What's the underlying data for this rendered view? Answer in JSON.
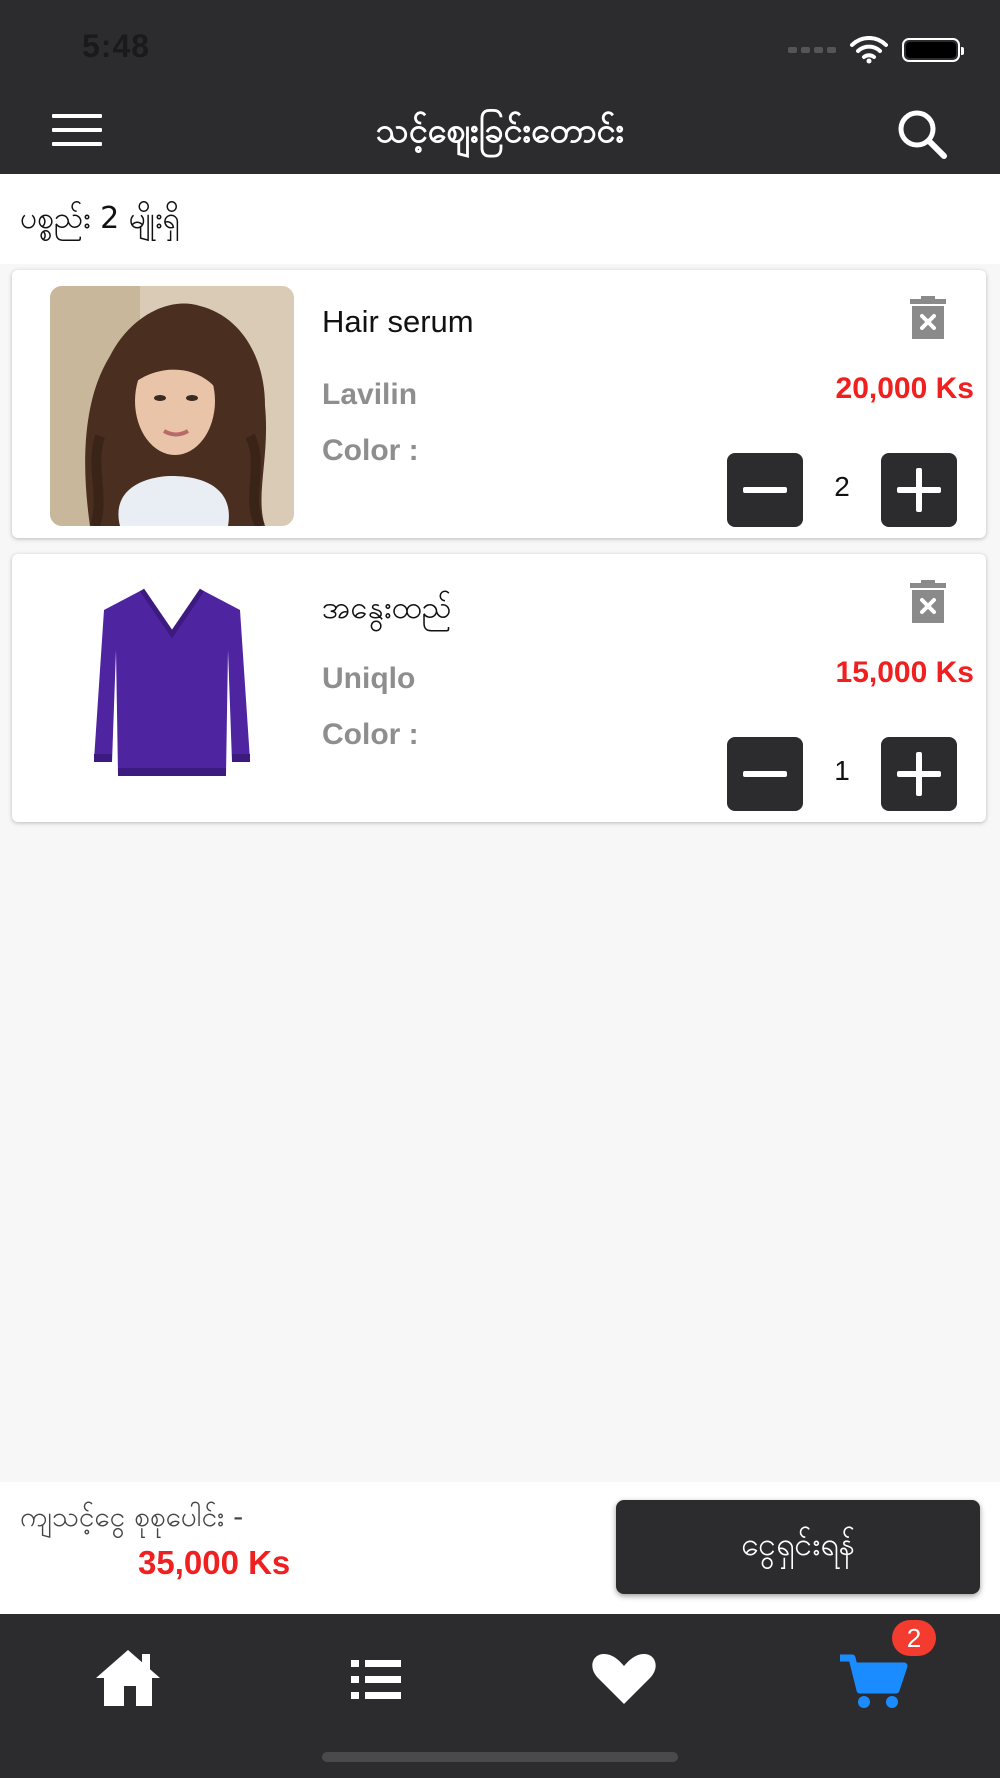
{
  "status_bar": {
    "time": "5:48"
  },
  "header": {
    "title": "သင့်ဈေးခြင်းတောင်း"
  },
  "cart": {
    "item_count": "ပစ္စည်း 2 မျိုးရှိ",
    "items": [
      {
        "name": "Hair serum",
        "brand": "Lavilin",
        "color_label": "Color :",
        "price": "20,000 Ks",
        "quantity": "2"
      },
      {
        "name": "အနွေးထည်",
        "brand": "Uniqlo",
        "color_label": "Color :",
        "price": "15,000 Ks",
        "quantity": "1"
      }
    ]
  },
  "footer": {
    "total_label": "ကျသင့်ငွေ စုစုပေါင်း -",
    "total_value": "35,000 Ks",
    "checkout_label": "ငွေရှင်းရန်"
  },
  "tab_bar": {
    "tabs": [
      "home-icon",
      "list-icon",
      "heart-icon",
      "cart-icon"
    ],
    "active_tab": "cart-icon",
    "cart_badge": "2"
  },
  "colors": {
    "dark": "#2c2c2e",
    "price_red": "#f02020",
    "active_blue": "#1a8cff",
    "badge_red": "#f33b30"
  }
}
